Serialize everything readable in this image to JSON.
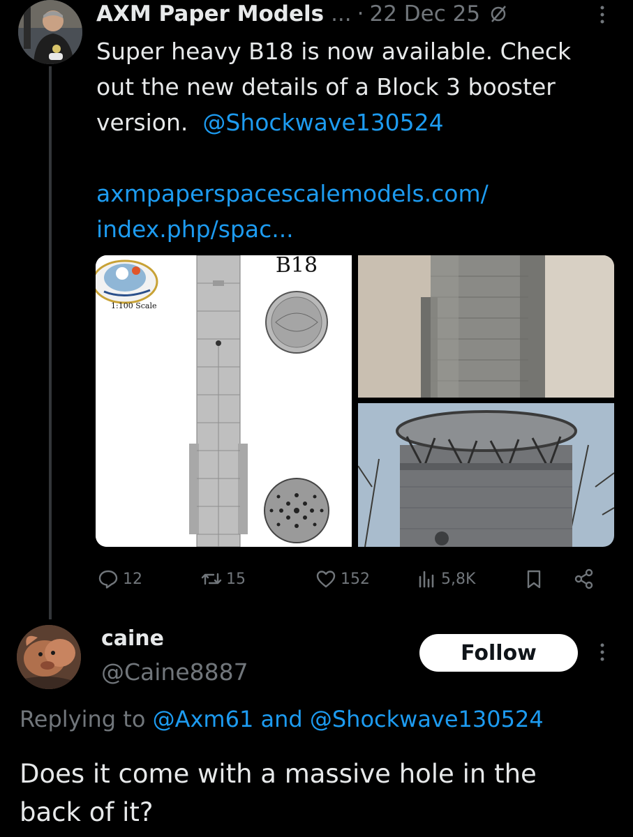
{
  "post": {
    "author": "AXM Paper Models",
    "ellipsis": "...",
    "dot": "·",
    "date": "22 Dec 25",
    "text_line1": "Super heavy B18 is now available. Check",
    "text_line2": "out the new details of a Block 3 booster",
    "text_line3": "version.",
    "mention": "@Shockwave130524",
    "link_line1": "axmpaperspacescalemodels.com/",
    "link_line2": "index.php/spac...",
    "media": {
      "left_title": "B18",
      "left_scale": "1:100 Scale"
    },
    "actions": {
      "replies": "12",
      "reposts": "15",
      "likes": "152",
      "views": "5,8K"
    }
  },
  "reply": {
    "name": "caine",
    "handle": "@Caine8887",
    "follow_label": "Follow",
    "replying_prefix": "Replying to",
    "replying_to_1": "@Axm61",
    "replying_and": "and",
    "replying_to_2": "@Shockwave130524",
    "text_line1": "Does it come with a massive hole in the",
    "text_line2": "back of it?"
  },
  "colors": {
    "background": "#000000",
    "text": "#e7e9ea",
    "secondary": "#71767b",
    "link": "#1d9bf0"
  }
}
